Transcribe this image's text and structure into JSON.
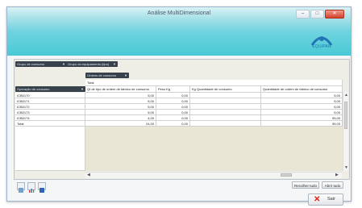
{
  "window": {
    "title": "Análise MultiDimensional",
    "logo_text": "EQUIPAR",
    "min_glyph": "–",
    "max_glyph": "□",
    "close_glyph": "✕"
  },
  "pivot": {
    "filter_fields": [
      "Grupo de consumo",
      "Grupo do equipamento (tipo)"
    ],
    "data_field": "Ordens de consumo",
    "column_total_label": "Total",
    "row_field": "Operação de consumo",
    "columns": [
      "Qt de tipo de ordem de fabrico de consumo",
      "Peso Kg",
      "Kg Quantidade de consumo",
      "Quantidade de ordem de fabrico de consumo"
    ],
    "rows": [
      {
        "label": "ICB0170",
        "values": [
          "5,00",
          "0,00",
          "",
          "5,00"
        ]
      },
      {
        "label": "ICB0171",
        "values": [
          "5,00",
          "0,00",
          "",
          "5,00"
        ]
      },
      {
        "label": "ICB0172",
        "values": [
          "5,00",
          "0,00",
          "",
          "5,00"
        ]
      },
      {
        "label": "ICB0173",
        "values": [
          "5,00",
          "0,00",
          "",
          "5,00"
        ]
      },
      {
        "label": "ICB0174",
        "values": [
          "4,00",
          "0,00",
          "",
          "95,00"
        ]
      },
      {
        "label": "Total",
        "values": [
          "24,00",
          "0,00",
          "",
          "95,00"
        ]
      }
    ]
  },
  "footer": {
    "collapse_label": "Recolher tudo",
    "expand_label": "Abrir tudo",
    "close_label": "Sair",
    "close_icon": "red-x-icon"
  },
  "colors": {
    "title_gradient_bottom": "#49c9d6",
    "field_button": "#36414c",
    "grid_empty": "#e9e6d6",
    "close_x": "#e0241b"
  }
}
